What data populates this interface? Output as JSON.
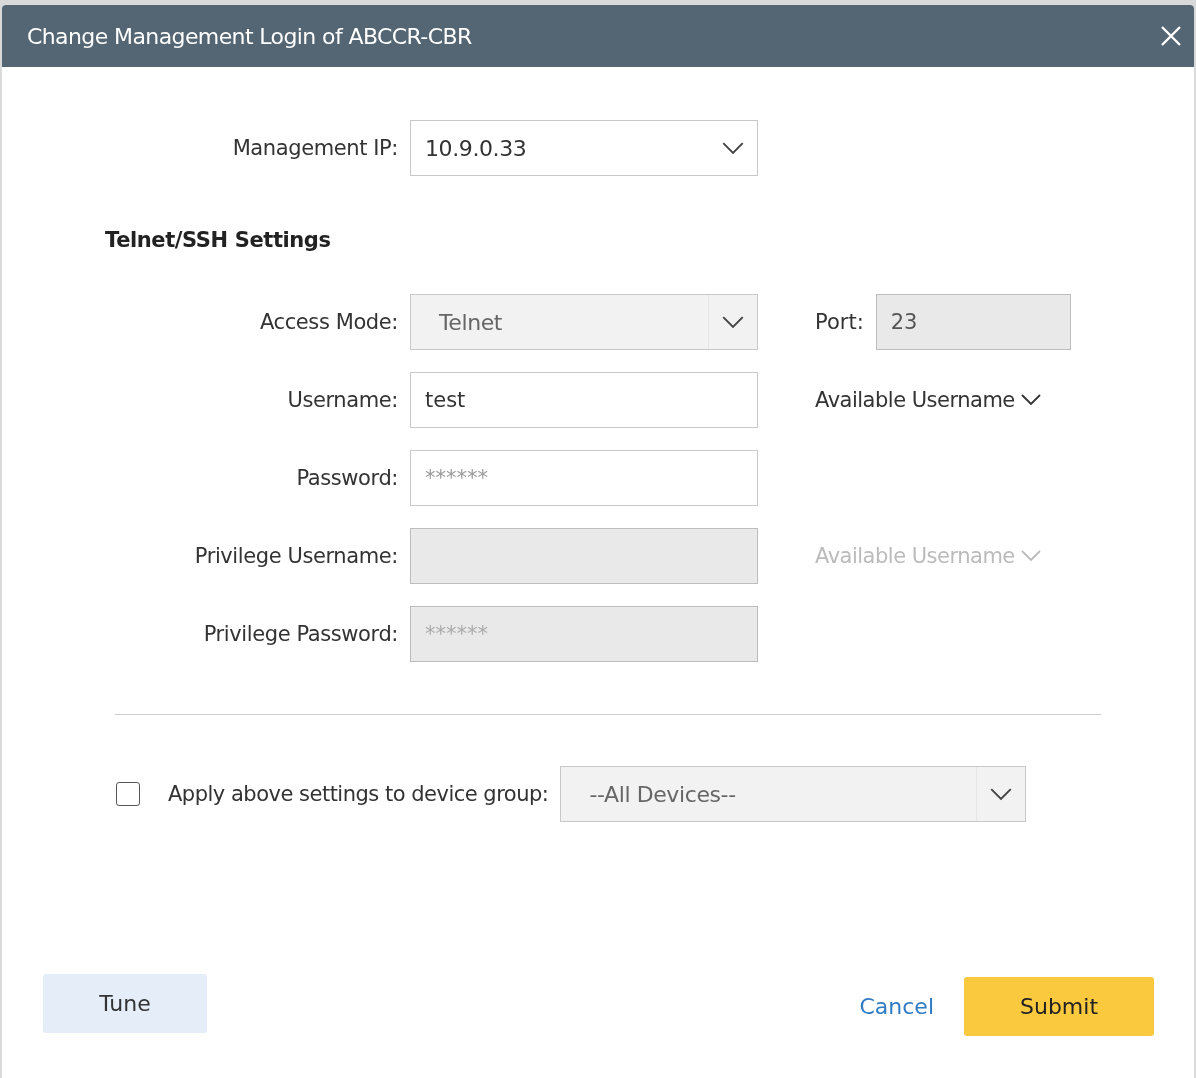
{
  "window": {
    "title": "Change Management Login of ABCCR-CBR"
  },
  "management_ip": {
    "label": "Management IP:",
    "value": "10.9.0.33"
  },
  "section_title": "Telnet/SSH Settings",
  "rows": [
    {
      "kind": "select",
      "label": "Access Mode:",
      "value": "Telnet",
      "disabled": true,
      "side": {
        "kind": "field",
        "label": "Port:",
        "value": "23",
        "disabled": true
      }
    },
    {
      "kind": "text",
      "label": "Username:",
      "value": "test",
      "disabled": false,
      "side": {
        "kind": "link",
        "label": "Available Username",
        "disabled": false
      }
    },
    {
      "kind": "password",
      "label": "Password:",
      "placeholder": "******",
      "disabled": false
    },
    {
      "kind": "text",
      "label": "Privilege Username:",
      "disabled": true,
      "side": {
        "kind": "link",
        "label": "Available Username",
        "disabled": true
      }
    },
    {
      "kind": "password",
      "label": "Privilege Password:",
      "placeholder": "******",
      "disabled": true
    }
  ],
  "apply": {
    "checked": false,
    "label": "Apply above settings to device group:",
    "value": "--All Devices--"
  },
  "buttons": [
    {
      "kind": "secondary",
      "label": "Tune"
    },
    {
      "kind": "link",
      "label": "Cancel"
    },
    {
      "kind": "primary",
      "label": "Submit"
    }
  ]
}
